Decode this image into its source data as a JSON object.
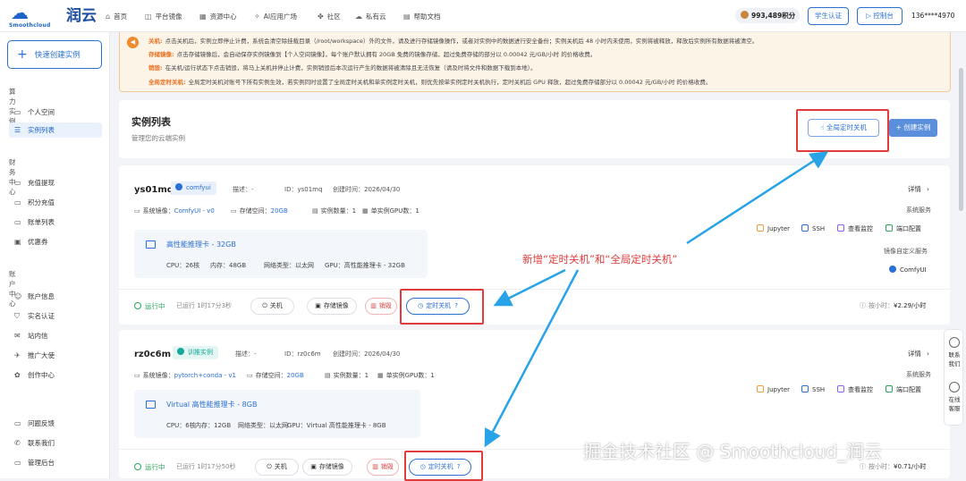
{
  "brand": {
    "name": "润云",
    "sub": "Smoothcloud"
  },
  "nav": [
    {
      "label": "首页",
      "icon": "home-icon",
      "glyph": "⌂"
    },
    {
      "label": "平台镜像",
      "icon": "layers-icon",
      "glyph": "◫"
    },
    {
      "label": "资源中心",
      "icon": "grid-icon",
      "glyph": "▦"
    },
    {
      "label": "AI应用广场",
      "icon": "sparkle-icon",
      "glyph": "✧"
    },
    {
      "label": "社区",
      "icon": "community-icon",
      "glyph": "✤"
    },
    {
      "label": "私有云",
      "icon": "cloud-icon",
      "glyph": "☁"
    },
    {
      "label": "帮助文档",
      "icon": "doc-icon",
      "glyph": "▤"
    }
  ],
  "top_right": {
    "points": "993,489积分",
    "student": "学生认证",
    "console": "控制台",
    "console_glyph": "▷",
    "phone": "136****4970"
  },
  "sidebar": {
    "quick_create": "快速创建实例",
    "sections": [
      {
        "title": "算力实例",
        "items": [
          {
            "label": "个人空间",
            "icon": "folder-icon",
            "glyph": "▭"
          },
          {
            "label": "实例列表",
            "icon": "list-icon",
            "glyph": "☰"
          }
        ]
      },
      {
        "title": "财务中心",
        "items": [
          {
            "label": "充值提现",
            "icon": "wallet-icon",
            "glyph": "▭"
          },
          {
            "label": "积分充值",
            "icon": "card-icon",
            "glyph": "▭"
          },
          {
            "label": "账单列表",
            "icon": "bill-icon",
            "glyph": "▭"
          },
          {
            "label": "优惠券",
            "icon": "coupon-icon",
            "glyph": "▣"
          }
        ]
      },
      {
        "title": "账户中心",
        "items": [
          {
            "label": "账户信息",
            "icon": "user-icon",
            "glyph": "☺"
          },
          {
            "label": "实名认证",
            "icon": "shield-icon",
            "glyph": "⛉"
          },
          {
            "label": "站内信",
            "icon": "mail-icon",
            "glyph": "✉"
          },
          {
            "label": "推广大使",
            "icon": "megaphone-icon",
            "glyph": "✈"
          },
          {
            "label": "创作中心",
            "icon": "palette-icon",
            "glyph": "✿"
          }
        ]
      },
      {
        "title": "",
        "items": [
          {
            "label": "问题反馈",
            "icon": "feedback-icon",
            "glyph": "▭"
          },
          {
            "label": "联系我们",
            "icon": "phone-icon",
            "glyph": "✆"
          },
          {
            "label": "管理后台",
            "icon": "admin-icon",
            "glyph": "▭"
          }
        ]
      }
    ]
  },
  "notice": [
    {
      "key": "关机:",
      "text": "点击关机后，实例立即停止计费，系统会清空除挂载目录（/root/workspace）外的文件，请及进行存储镜像操作，或者对实例中的数据进行安全备份；实例关机后 48 小时内未使用，实例将被释放，释放后实例所有数据将被清空。"
    },
    {
      "key": "存储镜像:",
      "text": "点击存储镜像后，会自动保存实例镜像到【个人空间镜像】，每个账户默认拥有 20GB 免费的镜像存储，超过免费存储的部分以 0.00042 元/GB/小时 的价格收费。"
    },
    {
      "key": "销毁:",
      "text": "在关机/运行状态下点击销毁，将马上关机并停止计费，实例销毁后本次运行产生的数据将被清除且无法恢复（请及时将文件和数据下载到本地）。"
    },
    {
      "key": "全局定时关机:",
      "text": "全局定时关机对账号下所有实例生效，若实例同时设置了全局定时关机和单实例定时关机，则优先按单实例定时关机执行，定时关机后 GPU 释放，超过免费存储部分以 0.00042 元/GB/小时 的价格收费。"
    }
  ],
  "list": {
    "title": "实例列表",
    "subtitle": "管理您的云端实例",
    "global_shutdown": "全局定时关机",
    "create": "+ 创建实例"
  },
  "labels": {
    "desc": "描述：-",
    "id_prefix": "ID：",
    "created_prefix": "创建时间：",
    "detail": "详情",
    "image_prefix": "系统镜像：",
    "storage_prefix": "存储空间：",
    "count_prefix": "实例数量：",
    "gpu_count_prefix": "单实例GPU数：",
    "system_service": "系统服务",
    "custom_service": "镜像自定义服务",
    "running": "运行中",
    "shutdown": "关机",
    "save_image": "存储镜像",
    "destroy": "销毁",
    "timer": "定时关机",
    "per_hour": "按小时："
  },
  "services": [
    "Jupyter",
    "SSH",
    "查看监控",
    "端口配置"
  ],
  "instances": [
    {
      "name": "ys01mq",
      "tag": "comfyui",
      "tag_color": "#2a6fd6",
      "id": "ys01mq",
      "created": "2026/04/30",
      "image": "ComfyUI - v0",
      "storage": "20GB",
      "count": "1",
      "gpus": "1",
      "gpu_name": "高性能推理卡 - 32GB",
      "cpu": "CPU：26核",
      "mem": "内存：48GB",
      "net": "网络类型：以太网",
      "gpu": "GPU：高性能推理卡 - 32GB",
      "custom_service": "ComfyUI",
      "runtime": "已运行 1时17分3秒",
      "price": "¥2.29/小时"
    },
    {
      "name": "rz0c6m",
      "tag": "训推实例",
      "tag_color": "#17a89a",
      "id": "rz0c6m",
      "created": "2026/04/30",
      "image": "pytorch+conda - v1",
      "storage": "20GB",
      "count": "1",
      "gpus": "1",
      "gpu_name": "Virtual 高性能推理卡 - 8GB",
      "cpu": "CPU：6核",
      "mem": "内存：12GB",
      "net": "网络类型：以太网",
      "gpu": "GPU：Virtual 高性能推理卡 - 8GB",
      "custom_service": "",
      "runtime": "已运行 1时17分50秒",
      "price": "¥0.71/小时"
    }
  ],
  "annotation": "新增“定时关机”和“全局定时关机”",
  "watermark": "掘金技术社区 @ Smoothcloud_润云",
  "float_panel": [
    {
      "label": "联系我们",
      "icon": "headset-icon"
    },
    {
      "label": "在线客服",
      "icon": "chat-icon"
    }
  ],
  "colors": {
    "brand": "#2a6fd6",
    "running": "#2aa45c",
    "annotation": "#e03c3c",
    "arrow": "#29a3e8"
  }
}
